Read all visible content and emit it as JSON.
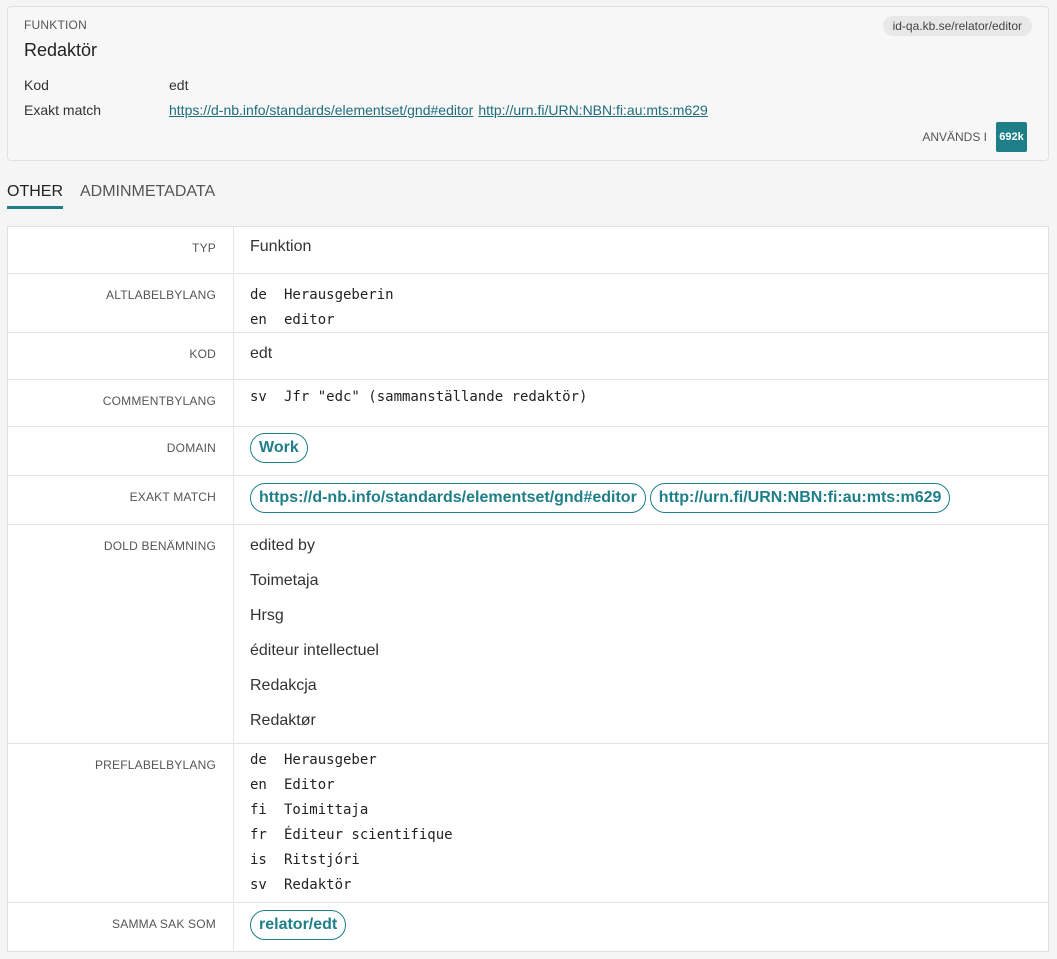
{
  "card": {
    "type": "FUNKTION",
    "title": "Redaktör",
    "url_pill": "id-qa.kb.se/relator/editor",
    "kod_label": "Kod",
    "kod_value": "edt",
    "match_label": "Exakt match",
    "match_links": [
      "https://d-nb.info/standards/elementset/gnd#editor",
      "http://urn.fi/URN:NBN:fi:au:mts:m629"
    ],
    "used_label": "ANVÄNDS I",
    "used_count": "692k"
  },
  "tabs": [
    "OTHER",
    "ADMINMETADATA"
  ],
  "rows": {
    "typ": {
      "key": "TYP",
      "value": "Funktion"
    },
    "altlabel": {
      "key": "ALTLABELBYLANG",
      "items": [
        {
          "lang": "de",
          "text": "Herausgeberin"
        },
        {
          "lang": "en",
          "text": "editor"
        }
      ]
    },
    "kod": {
      "key": "KOD",
      "value": "edt"
    },
    "comment": {
      "key": "COMMENTBYLANG",
      "items": [
        {
          "lang": "sv",
          "text": "Jfr \"edc\" (sammanställande redaktör)"
        }
      ]
    },
    "domain": {
      "key": "DOMAIN",
      "chips": [
        "Work"
      ]
    },
    "exakt": {
      "key": "EXAKT MATCH",
      "chips": [
        "https://d-nb.info/standards/elementset/gnd#editor",
        "http://urn.fi/URN:NBN:fi:au:mts:m629"
      ]
    },
    "dold": {
      "key": "DOLD BENÄMNING",
      "values": [
        "edited by",
        "Toimetaja",
        "Hrsg",
        "éditeur intellectuel",
        "Redakcja",
        "Redaktør"
      ]
    },
    "preflabel": {
      "key": "PREFLABELBYLANG",
      "items": [
        {
          "lang": "de",
          "text": "Herausgeber"
        },
        {
          "lang": "en",
          "text": "Editor"
        },
        {
          "lang": "fi",
          "text": "Toimittaja"
        },
        {
          "lang": "fr",
          "text": "Éditeur scientifique"
        },
        {
          "lang": "is",
          "text": "Ritstjóri"
        },
        {
          "lang": "sv",
          "text": "Redaktör"
        }
      ]
    },
    "samma": {
      "key": "SAMMA SAK SOM",
      "chips": [
        "relator/edt"
      ]
    }
  },
  "colors": {
    "accent": "#1e7f89",
    "link": "#1f6d7d"
  }
}
